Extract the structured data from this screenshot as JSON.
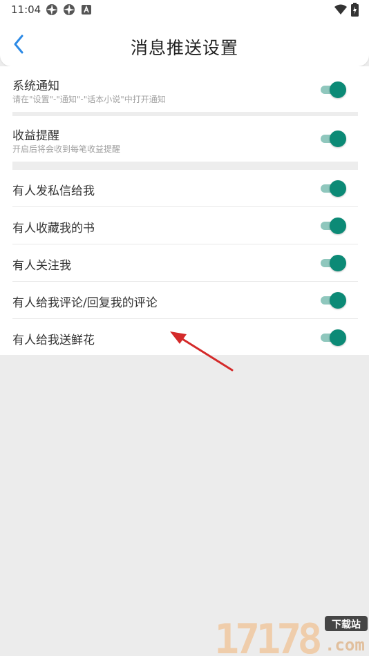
{
  "status_bar": {
    "time": "11:04",
    "icons": [
      "aperture-icon",
      "aperture-icon",
      "letter-a-icon",
      "wifi-icon",
      "battery-charging-icon"
    ]
  },
  "header": {
    "back_icon": "chevron-left-icon",
    "title": "消息推送设置"
  },
  "settings": [
    {
      "title": "系统通知",
      "description": "请在\"设置\"-\"通知\"-\"话本小说\"中打开通知",
      "enabled": true
    },
    {
      "title": "收益提醒",
      "description": "开启后将会收到每笔收益提醒",
      "enabled": true
    },
    {
      "title": "有人发私信给我",
      "enabled": true
    },
    {
      "title": "有人收藏我的书",
      "enabled": true
    },
    {
      "title": "有人关注我",
      "enabled": true
    },
    {
      "title": "有人给我评论/回复我的评论",
      "enabled": true
    },
    {
      "title": "有人给我送鲜花",
      "enabled": true
    }
  ],
  "watermark": {
    "number": "17178",
    "badge": "下载站",
    "domain": ".com"
  },
  "colors": {
    "accent": "#0c8a76",
    "toggle_track": "#8fc7bd",
    "annotation_arrow": "#d42a2a",
    "background": "#ececec"
  }
}
